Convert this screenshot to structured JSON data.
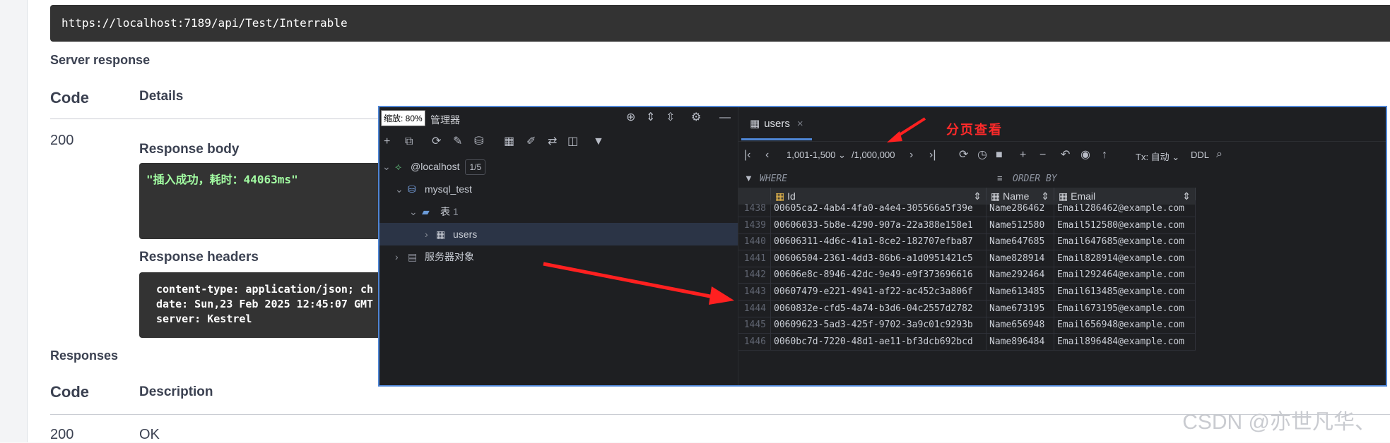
{
  "swagger": {
    "request_url": "https://localhost:7189/api/Test/Interrable",
    "server_response_label": "Server response",
    "code_header": "Code",
    "details_header": "Details",
    "status_code": "200",
    "response_body_label": "Response body",
    "response_body": "\"插入成功，耗时：44063ms\"",
    "response_headers_label": "Response headers",
    "headers": [
      "content-type: application/json; ch",
      "date: Sun,23 Feb 2025 12:45:07 GMT",
      "server: Kestrel"
    ],
    "responses_label": "Responses",
    "responses_code_header": "Code",
    "description_header": "Description",
    "resp_code": "200",
    "resp_desc": "OK"
  },
  "ide": {
    "zoom_label": "缩放: 80%",
    "panel_title": "管理器",
    "tree": [
      {
        "label": "@localhost",
        "badge": "1/5"
      },
      {
        "label": "mysql_test"
      },
      {
        "label": "表",
        "count": "1"
      },
      {
        "label": "users"
      },
      {
        "label": "服务器对象"
      }
    ],
    "tab_label": "users",
    "annotation": "分页查看",
    "pager": {
      "range": "1,001-1,500",
      "total": "/1,000,000"
    },
    "tx_label": "Tx: 自动",
    "ddl_label": "DDL",
    "where_label": "WHERE",
    "order_by_label": "ORDER BY",
    "columns": [
      "Id",
      "Name",
      "Email"
    ],
    "rows": [
      {
        "n": "1438",
        "id": "00605ca2-4ab4-4fa0-a4e4-305566a5f39e",
        "name": "Name286462",
        "email": "Email286462@example.com"
      },
      {
        "n": "1439",
        "id": "00606033-5b8e-4290-907a-22a388e158e1",
        "name": "Name512580",
        "email": "Email512580@example.com"
      },
      {
        "n": "1440",
        "id": "00606311-4d6c-41a1-8ce2-182707efba87",
        "name": "Name647685",
        "email": "Email647685@example.com"
      },
      {
        "n": "1441",
        "id": "00606504-2361-4dd3-86b6-a1d0951421c5",
        "name": "Name828914",
        "email": "Email828914@example.com"
      },
      {
        "n": "1442",
        "id": "00606e8c-8946-42dc-9e49-e9f373696616",
        "name": "Name292464",
        "email": "Email292464@example.com"
      },
      {
        "n": "1443",
        "id": "00607479-e221-4941-af22-ac452c3a806f",
        "name": "Name613485",
        "email": "Email613485@example.com"
      },
      {
        "n": "1444",
        "id": "0060832e-cfd5-4a74-b3d6-04c2557d2782",
        "name": "Name673195",
        "email": "Email673195@example.com"
      },
      {
        "n": "1445",
        "id": "00609623-5ad3-425f-9702-3a9c01c9293b",
        "name": "Name656948",
        "email": "Email656948@example.com"
      },
      {
        "n": "1446",
        "id": "0060bc7d-7220-48d1-ae11-bf3dcb692bcd",
        "name": "Name896484",
        "email": "Email896484@example.com"
      }
    ]
  },
  "watermark": "CSDN @亦世凡华、"
}
